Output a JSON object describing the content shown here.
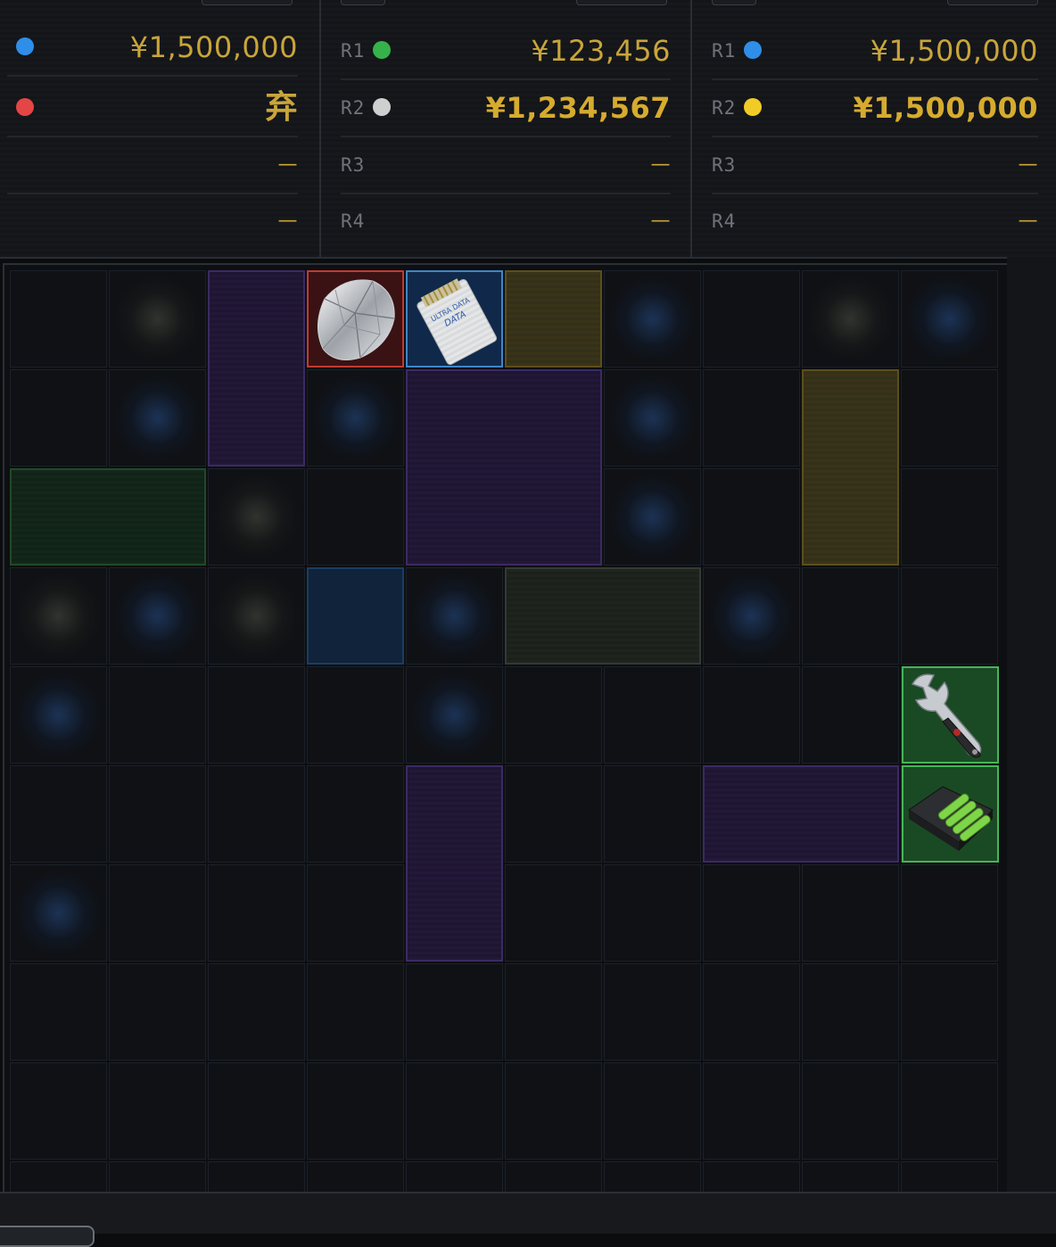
{
  "panels": [
    {
      "rows": [
        {
          "label": "",
          "dot": "#2f8ee8",
          "value": "¥1,500,000",
          "style": "normal"
        },
        {
          "label": "",
          "dot": "#e44545",
          "value": "弃",
          "style": "big"
        },
        {
          "label": "",
          "dot": "",
          "value": "—",
          "style": "dash"
        },
        {
          "label": "",
          "dot": "",
          "value": "—",
          "style": "dash"
        }
      ]
    },
    {
      "rows": [
        {
          "label": "R1",
          "dot": "#36b24a",
          "value": "¥123,456",
          "style": "normal"
        },
        {
          "label": "R2",
          "dot": "#cfcfcf",
          "value": "¥1,234,567",
          "style": "bold"
        },
        {
          "label": "R3",
          "dot": "",
          "value": "—",
          "style": "dash"
        },
        {
          "label": "R4",
          "dot": "",
          "value": "—",
          "style": "dash"
        }
      ]
    },
    {
      "rows": [
        {
          "label": "R1",
          "dot": "#2f8ee8",
          "value": "¥1,500,000",
          "style": "normal"
        },
        {
          "label": "R2",
          "dot": "#f2cc26",
          "value": "¥1,500,000",
          "style": "bold"
        },
        {
          "label": "R3",
          "dot": "",
          "value": "—",
          "style": "dash"
        },
        {
          "label": "R4",
          "dot": "",
          "value": "—",
          "style": "dash"
        }
      ]
    }
  ],
  "stash": {
    "columns": 10,
    "rows": 10,
    "items": [
      {
        "name": "diamond-item",
        "icon": "diamond-icon",
        "rarity": "red"
      },
      {
        "name": "memory-card-item",
        "icon": "sd-card-icon",
        "rarity": "blue",
        "label": "ULTRA DATA"
      },
      {
        "name": "wrench-item",
        "icon": "wrench-icon",
        "rarity": "green"
      },
      {
        "name": "battery-charger-item",
        "icon": "battery-charger-icon",
        "rarity": "green"
      }
    ],
    "placeholders": [
      {
        "name": "purple-slot",
        "color": "purple"
      },
      {
        "name": "yellow-slot",
        "color": "yellow"
      },
      {
        "name": "green-slot",
        "color": "green"
      },
      {
        "name": "olive-slot",
        "color": "olive"
      },
      {
        "name": "blue-slot",
        "color": "blue"
      }
    ]
  },
  "colors": {
    "accent_gold": "#c9a53a",
    "rarity_red": "#c23b30",
    "rarity_blue": "#3f86c9",
    "rarity_green": "#47b457",
    "rarity_purple": "#3b2a63"
  }
}
